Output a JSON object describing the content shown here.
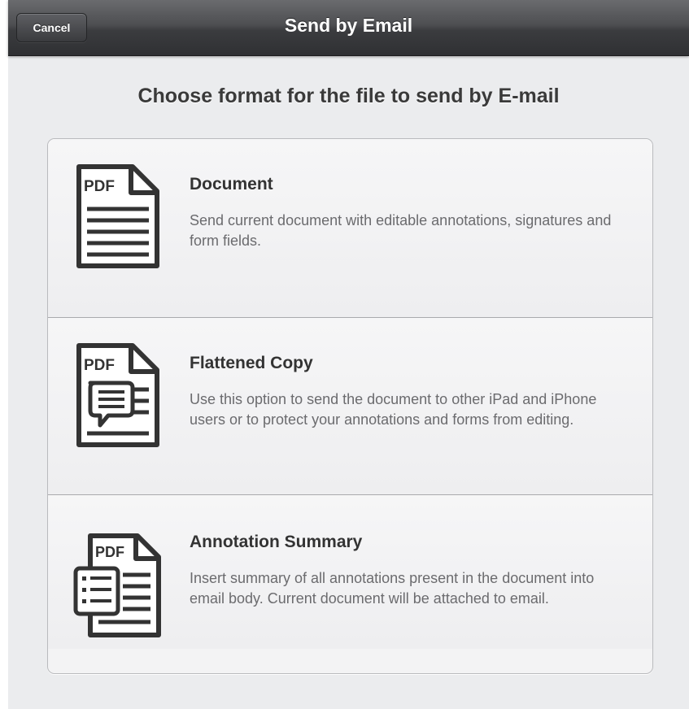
{
  "navbar": {
    "cancel_label": "Cancel",
    "title": "Send by Email"
  },
  "heading": "Choose format for the file to send by E-mail",
  "options": [
    {
      "title": "Document",
      "description": "Send current document with editable annotations, signatures and form fields.",
      "icon": "pdf-document-icon",
      "icon_text": "PDF"
    },
    {
      "title": "Flattened Copy",
      "description": "Use this option to send the document to other iPad and iPhone users or to protect your annotations and forms from editing.",
      "icon": "pdf-flattened-icon",
      "icon_text": "PDF"
    },
    {
      "title": "Annotation Summary",
      "description": "Insert summary of all annotations present in the document into email body. Current document will be attached to email.",
      "icon": "pdf-summary-icon",
      "icon_text": "PDF"
    }
  ],
  "colors": {
    "navbar": "#3b3c3f",
    "background": "#ebecee",
    "icon": "#333333"
  }
}
